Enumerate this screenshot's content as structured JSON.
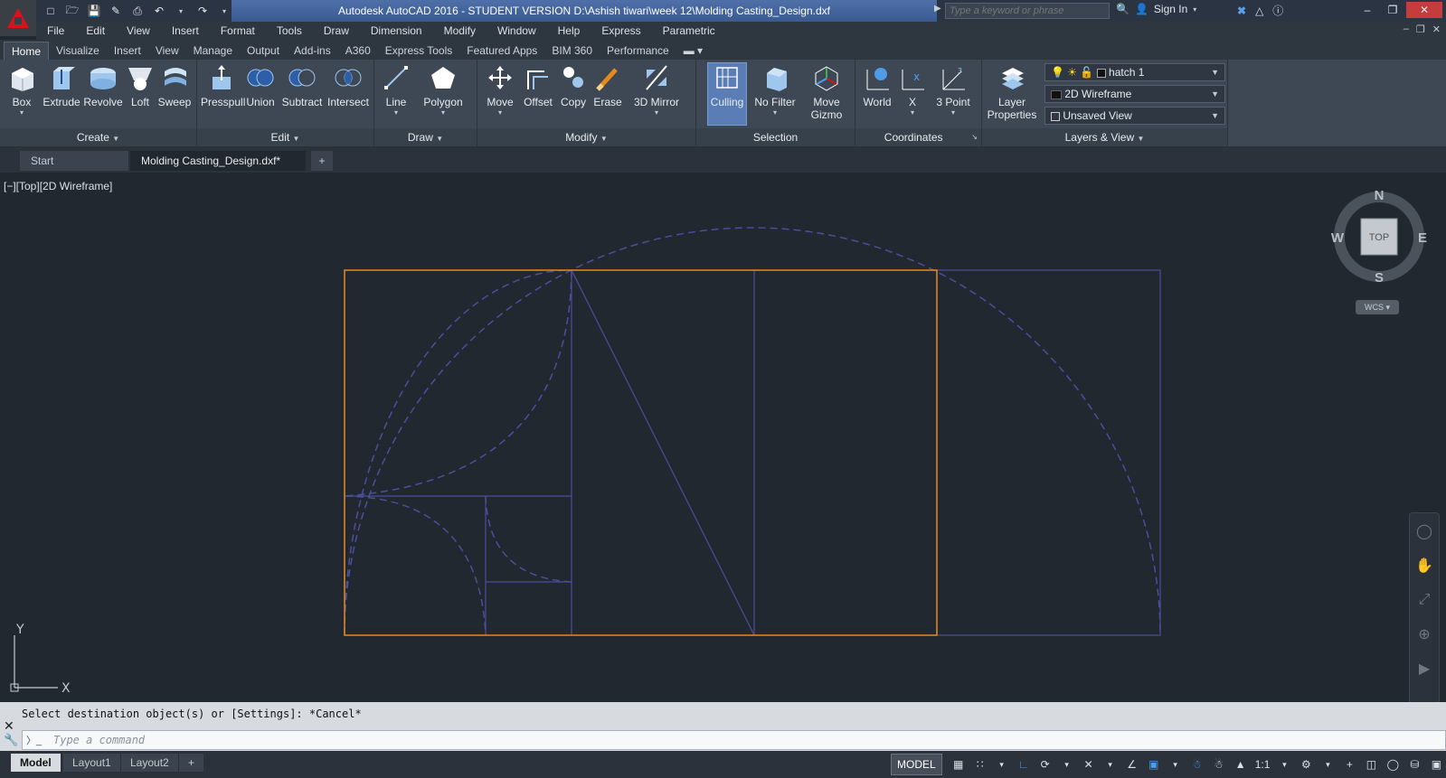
{
  "window": {
    "title": "Autodesk AutoCAD 2016 - STUDENT VERSION    D:\\Ashish tiwari\\week 12\\Molding Casting_Design.dxf",
    "search_placeholder": "Type a keyword or phrase",
    "sign_in": "Sign In"
  },
  "menu": [
    "File",
    "Edit",
    "View",
    "Insert",
    "Format",
    "Tools",
    "Draw",
    "Dimension",
    "Modify",
    "Window",
    "Help",
    "Express",
    "Parametric"
  ],
  "ribbon_tabs": [
    "Home",
    "Visualize",
    "Insert",
    "View",
    "Manage",
    "Output",
    "Add-ins",
    "A360",
    "Express Tools",
    "Featured Apps",
    "BIM 360",
    "Performance"
  ],
  "ribbon": {
    "create": {
      "title": "Create",
      "tools": [
        "Box",
        "Extrude",
        "Revolve",
        "Loft",
        "Sweep"
      ]
    },
    "edit": {
      "title": "Edit",
      "tools": [
        "Presspull",
        "Union",
        "Subtract",
        "Intersect"
      ]
    },
    "draw": {
      "title": "Draw",
      "tools": [
        "Line",
        "Polygon"
      ]
    },
    "modify": {
      "title": "Modify",
      "tools": [
        "Move",
        "Offset",
        "Copy",
        "Erase",
        "3D Mirror"
      ]
    },
    "selection": {
      "title": "Selection",
      "tools": [
        "Culling",
        "No Filter",
        "Move",
        "Gizmo"
      ]
    },
    "coordinates": {
      "title": "Coordinates",
      "tools": [
        "World",
        "X",
        "3 Point"
      ]
    },
    "layers": {
      "title": "Layers & View",
      "layer_properties_1": "Layer",
      "layer_properties_2": "Properties",
      "layer_name": "hatch 1",
      "visual_style": "2D Wireframe",
      "view": "Unsaved View"
    }
  },
  "file_tabs": {
    "start": "Start",
    "document": "Molding Casting_Design.dxf*"
  },
  "viewport_label": "[−][Top][2D Wireframe]",
  "viewcube": {
    "n": "N",
    "s": "S",
    "e": "E",
    "w": "W",
    "face": "TOP",
    "wcs": "WCS"
  },
  "ucs": {
    "x": "X",
    "y": "Y"
  },
  "command": {
    "history": "Select destination object(s) or [Settings]: *Cancel*",
    "placeholder": "Type a command"
  },
  "layouts": [
    "Model",
    "Layout1",
    "Layout2"
  ],
  "status": {
    "model": "MODEL",
    "scale": "1:1"
  },
  "colors": {
    "orange": "#e8891c",
    "blue_line": "#4b4e9a",
    "background": "#212830"
  }
}
